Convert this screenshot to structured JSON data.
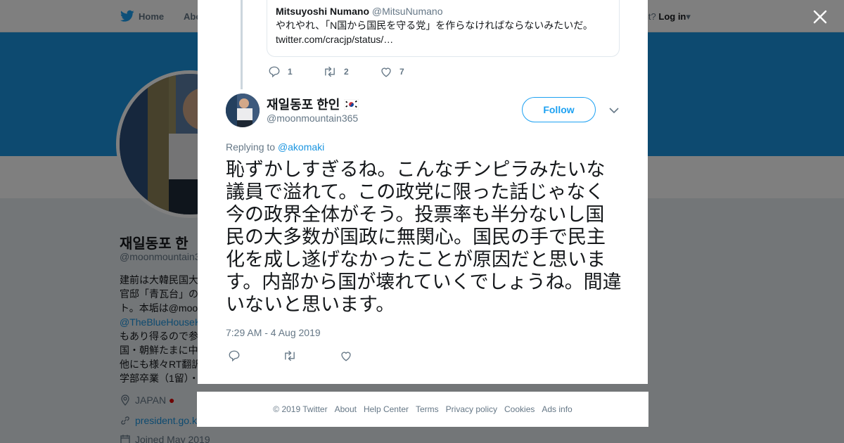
{
  "background": {
    "nav": {
      "home_label": "Home",
      "about_label": "Abo",
      "account_prompt": "account?",
      "login_label": "Log in"
    },
    "profile": {
      "name": "재일동포 한",
      "handle": "@moonmountain3",
      "bio_lines": [
        "建前は大韓民国大",
        "官邸「青瓦台」の",
        "ト。本垢は@moo",
        "@TheBlueHouseK",
        "もあり得るので参",
        "国・朝鮮たまに中",
        "他にも様々RT翻訳",
        "学部卒業（1留）・"
      ],
      "location": "JAPAN",
      "website": "president.go.k",
      "joined": "Joined May 2019"
    }
  },
  "modal": {
    "quoted": {
      "name": "Mitsuyoshi Numano",
      "handle": "@MitsuNumano",
      "text": "やれやれ、「N国から国民を守る党」を作らなければならないみたいだ。",
      "link": "twitter.com/cracjp/status/…"
    },
    "prev_actions": {
      "replies": "1",
      "retweets": "2",
      "likes": "7"
    },
    "author": {
      "name": "재일동포 한인",
      "handle": "@moonmountain365"
    },
    "follow_label": "Follow",
    "replying_prefix": "Replying to",
    "replying_to": "@akomaki",
    "tweet_text": "恥ずかしすぎるね。こんなチンピラみたいな議員で溢れて。この政党に限った話じゃなく今の政界全体がそう。投票率も半分ないし国民の大多数が国政に無関心。国民の手で民主化を成し遂げなかったことが原因だと思います。内部から国が壊れていくでしょうね。間違いないと思います。",
    "timestamp": "7:29 AM - 4 Aug 2019"
  },
  "footer": [
    "© 2019 Twitter",
    "About",
    "Help Center",
    "Terms",
    "Privacy policy",
    "Cookies",
    "Ads info"
  ],
  "colors": {
    "brand_blue": "#1da1f2",
    "link_blue": "#1b95e0",
    "muted": "#657786"
  },
  "icons": [
    "twitter-bird-icon",
    "close-icon",
    "reply-icon",
    "retweet-icon",
    "like-icon",
    "chevron-down-icon",
    "location-icon",
    "link-icon",
    "calendar-icon"
  ]
}
